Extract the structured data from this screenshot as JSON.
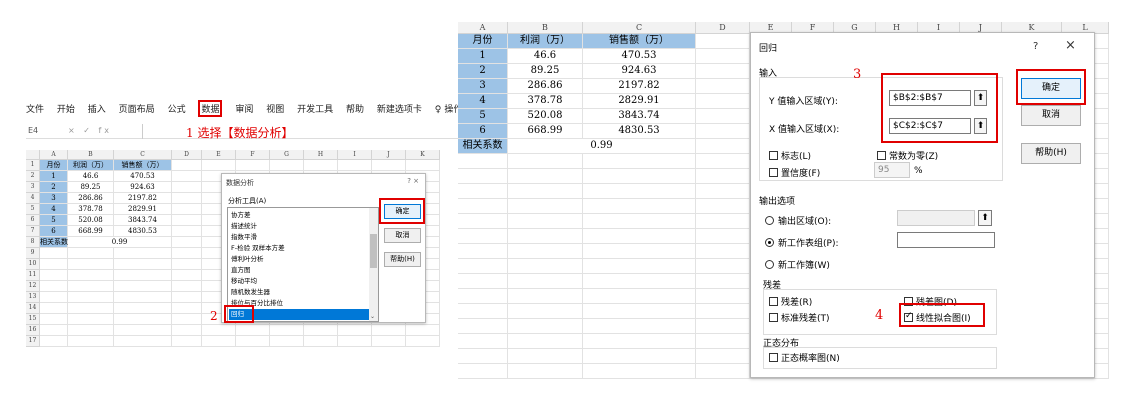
{
  "ribbon": {
    "tabs": [
      "文件",
      "开始",
      "插入",
      "页面布局",
      "公式",
      "数据",
      "审阅",
      "视图",
      "开发工具",
      "帮助",
      "新建选项卡"
    ],
    "search": "操作说明搜索"
  },
  "formula_bar": {
    "cell_ref": "E4",
    "controls": "× ✓ fx"
  },
  "annotations": {
    "step1": "1 选择【数据分析】",
    "step2": "2",
    "step3": "3",
    "step4": "4"
  },
  "sheet_left": {
    "columns": [
      "A",
      "B",
      "C",
      "D",
      "E",
      "F",
      "G",
      "H",
      "I",
      "J",
      "K"
    ],
    "rows": [
      "1",
      "2",
      "3",
      "4",
      "5",
      "6",
      "7",
      "8",
      "9",
      "10",
      "11",
      "12",
      "13",
      "14",
      "15",
      "16",
      "17"
    ]
  },
  "sheet_right": {
    "columns": [
      "A",
      "B",
      "C",
      "D",
      "E",
      "F",
      "G",
      "H",
      "I",
      "J",
      "K",
      "L"
    ]
  },
  "table": {
    "headers": [
      "月份",
      "利润（万）",
      "销售额（万）"
    ],
    "rows": [
      [
        "1",
        "46.6",
        "470.53"
      ],
      [
        "2",
        "89.25",
        "924.63"
      ],
      [
        "3",
        "286.86",
        "2197.82"
      ],
      [
        "4",
        "378.78",
        "2829.91"
      ],
      [
        "5",
        "520.08",
        "3843.74"
      ],
      [
        "6",
        "668.99",
        "4830.53"
      ]
    ],
    "corr_label": "相关系数",
    "corr_value": "0.99"
  },
  "data_analysis_dialog": {
    "title": "数据分析",
    "controls": "? ×",
    "tools_label": "分析工具(A)",
    "tools": [
      "协方差",
      "描述统计",
      "指数平滑",
      "F-检验 双样本方差",
      "傅利叶分析",
      "直方图",
      "移动平均",
      "随机数发生器",
      "排位与百分比排位",
      "回归"
    ],
    "ok": "确定",
    "cancel": "取消",
    "help": "帮助(H)"
  },
  "regression_dialog": {
    "title": "回归",
    "help_icon": "?",
    "close_icon": "×",
    "input_group": "输入",
    "y_label": "Y 值输入区域(Y):",
    "y_value": "$B$2:$B$7",
    "x_label": "X 值输入区域(X):",
    "x_value": "$C$2:$C$7",
    "labels_cb": "标志(L)",
    "const_zero_cb": "常数为零(Z)",
    "confidence_cb": "置信度(F)",
    "confidence_value": "95",
    "percent": "%",
    "output_group": "输出选项",
    "output_range": "输出区域(O):",
    "new_sheet": "新工作表组(P):",
    "new_book": "新工作簿(W)",
    "residuals_group": "残差",
    "residuals_cb": "残差(R)",
    "residual_plot_cb": "残差图(D)",
    "std_residuals_cb": "标准残差(T)",
    "line_fit_cb": "线性拟合图(I)",
    "normal_group": "正态分布",
    "normal_cb": "正态概率图(N)",
    "ok": "确定",
    "cancel": "取消",
    "help": "帮助(H)"
  }
}
